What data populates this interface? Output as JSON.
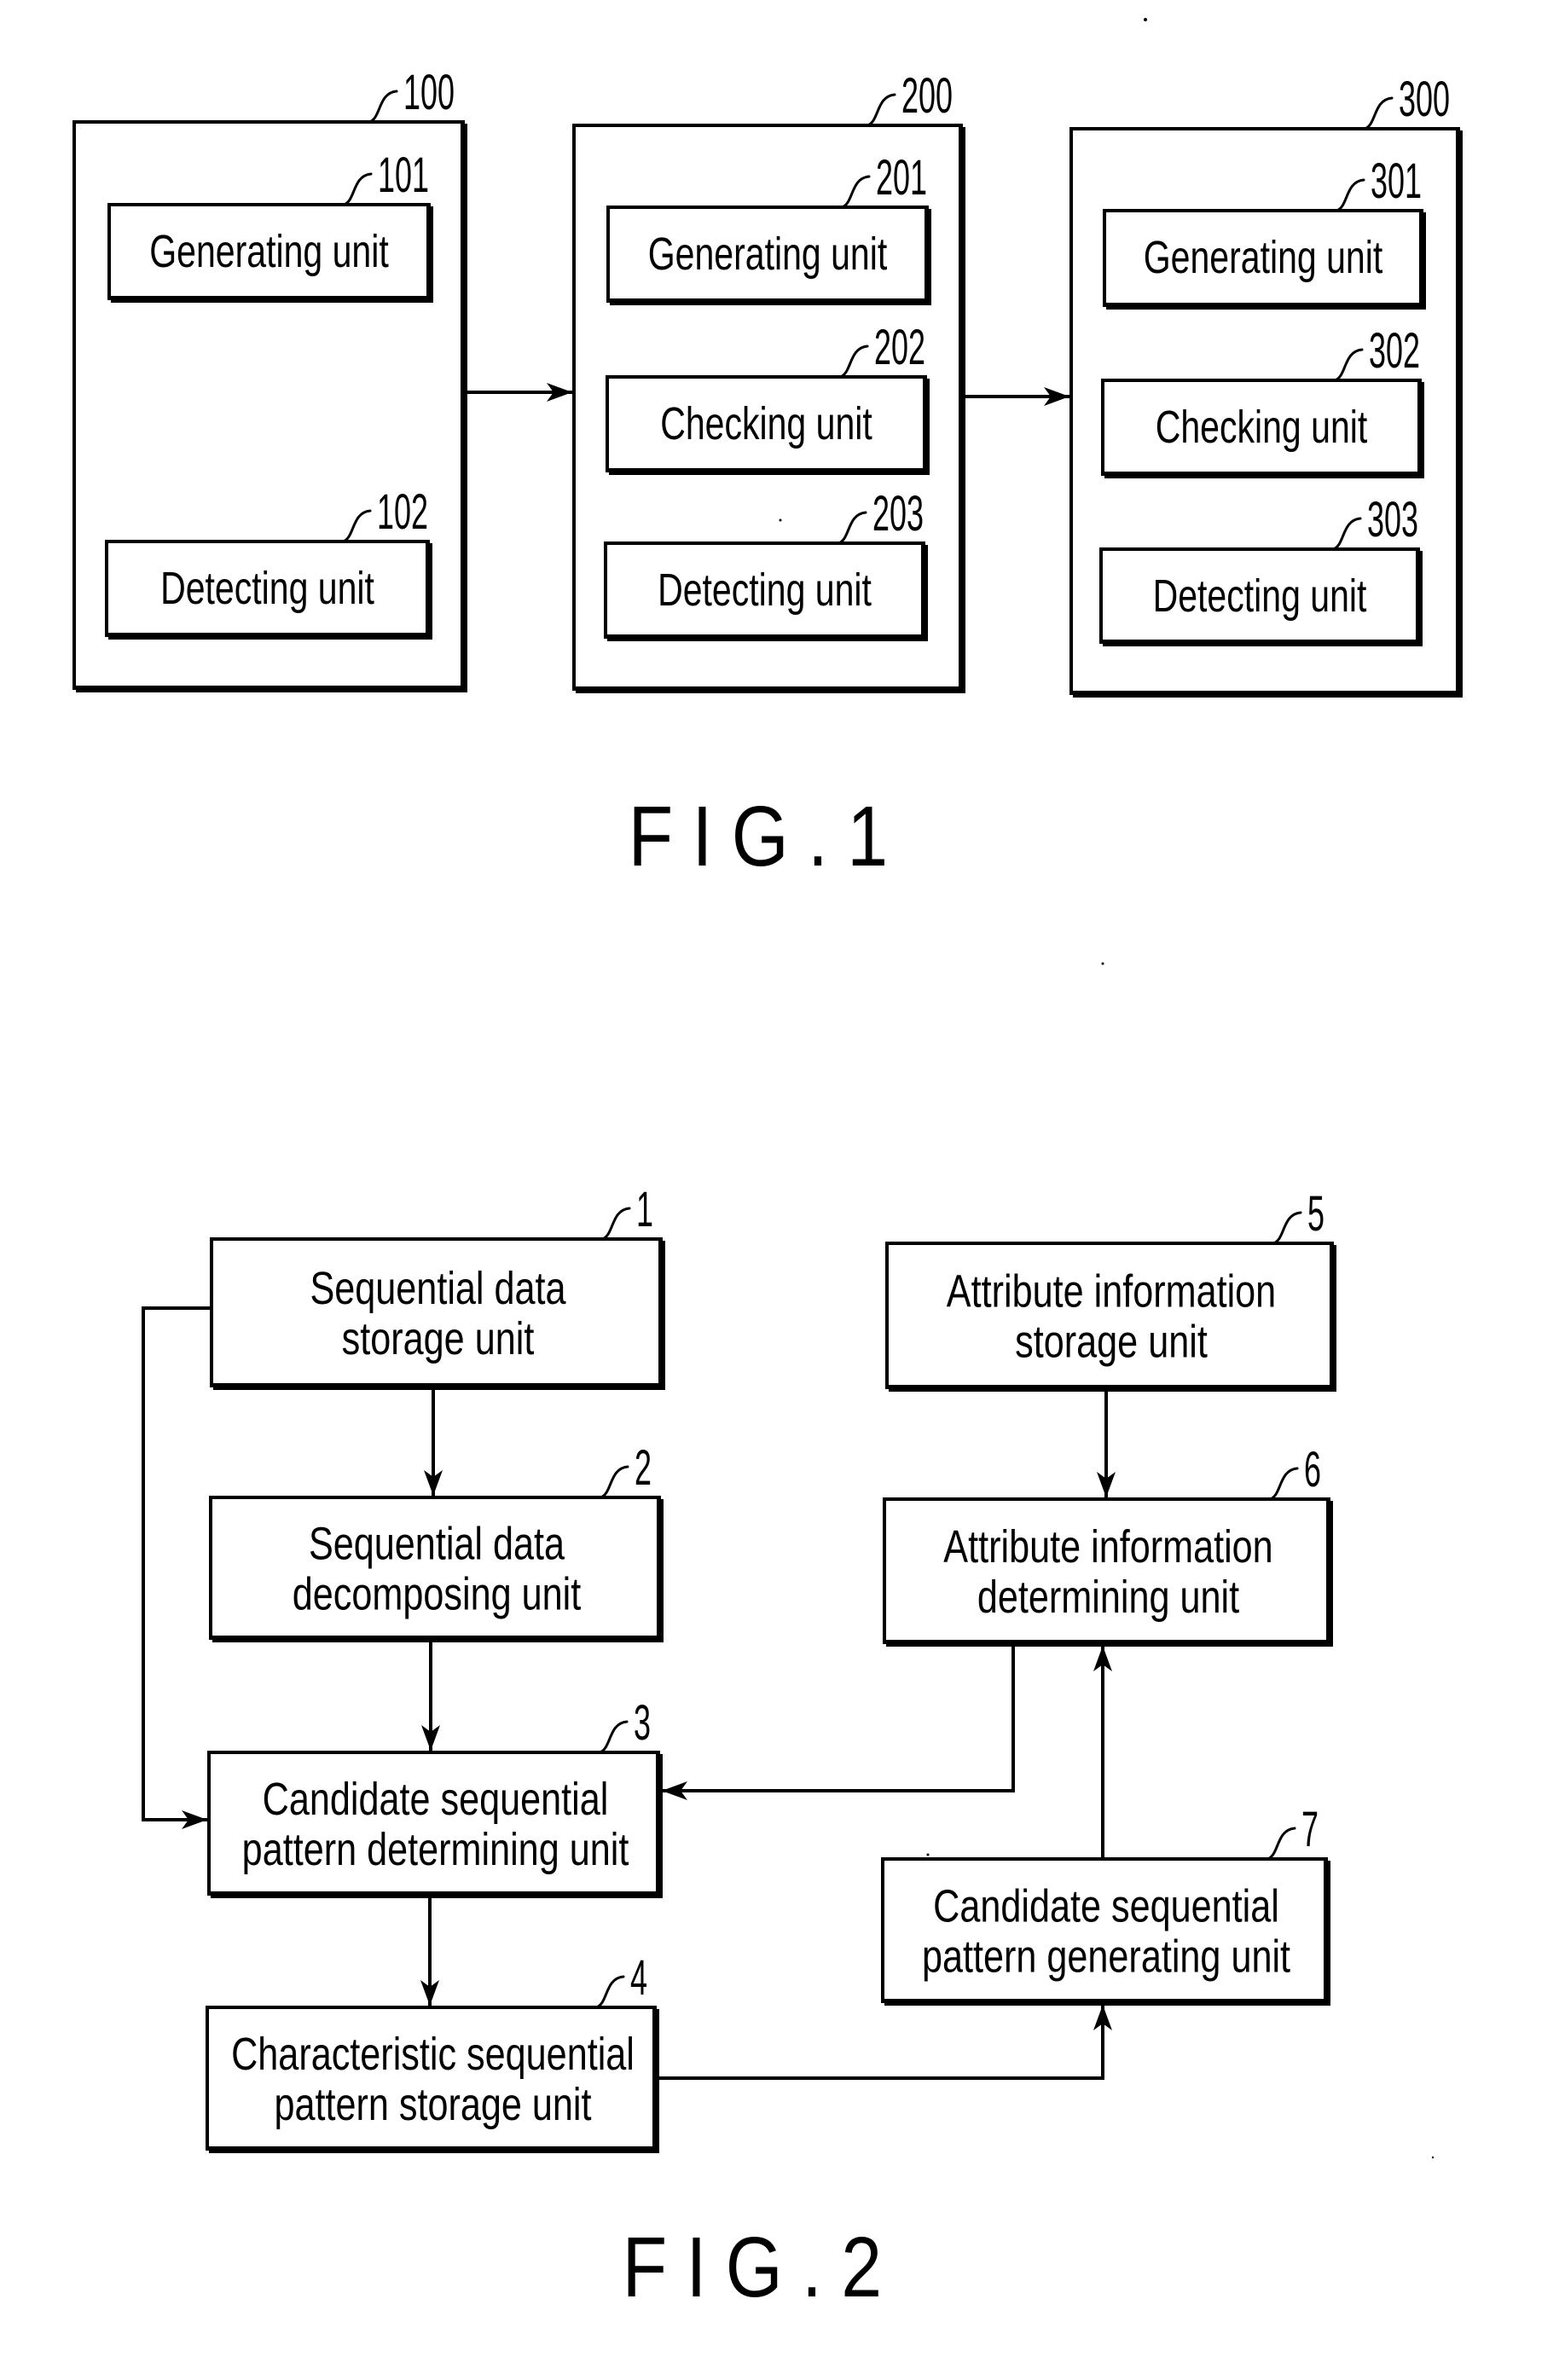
{
  "page": {
    "background": "#ffffff",
    "ink": "#000000"
  },
  "fig1": {
    "caption": "FIG.1",
    "blocks": [
      {
        "ref": "100",
        "units": [
          {
            "ref": "101",
            "label": "Generating unit"
          },
          {
            "ref": "102",
            "label": "Detecting unit"
          }
        ]
      },
      {
        "ref": "200",
        "units": [
          {
            "ref": "201",
            "label": "Generating unit"
          },
          {
            "ref": "202",
            "label": "Checking unit"
          },
          {
            "ref": "203",
            "label": "Detecting unit"
          }
        ]
      },
      {
        "ref": "300",
        "units": [
          {
            "ref": "301",
            "label": "Generating unit"
          },
          {
            "ref": "302",
            "label": "Checking unit"
          },
          {
            "ref": "303",
            "label": "Detecting unit"
          }
        ]
      }
    ],
    "connections": [
      {
        "from": "100",
        "to": "200"
      },
      {
        "from": "200",
        "to": "300"
      }
    ]
  },
  "fig2": {
    "caption": "FIG.2",
    "units": [
      {
        "ref": "1",
        "lines": [
          "Sequential data",
          "storage unit"
        ]
      },
      {
        "ref": "2",
        "lines": [
          "Sequential data",
          "decomposing unit"
        ]
      },
      {
        "ref": "3",
        "lines": [
          "Candidate sequential",
          "pattern determining unit"
        ]
      },
      {
        "ref": "4",
        "lines": [
          "Characteristic sequential",
          "pattern storage unit"
        ]
      },
      {
        "ref": "5",
        "lines": [
          "Attribute information",
          "storage unit"
        ]
      },
      {
        "ref": "6",
        "lines": [
          "Attribute information",
          "determining unit"
        ]
      },
      {
        "ref": "7",
        "lines": [
          "Candidate sequential",
          "pattern generating unit"
        ]
      }
    ],
    "connections": [
      {
        "from": "1",
        "to": "2"
      },
      {
        "from": "2",
        "to": "3"
      },
      {
        "from": "3",
        "to": "4"
      },
      {
        "from": "1",
        "to": "3"
      },
      {
        "from": "5",
        "to": "6"
      },
      {
        "from": "6",
        "to": "3"
      },
      {
        "from": "7",
        "to": "6"
      },
      {
        "from": "4",
        "to": "7"
      }
    ]
  }
}
